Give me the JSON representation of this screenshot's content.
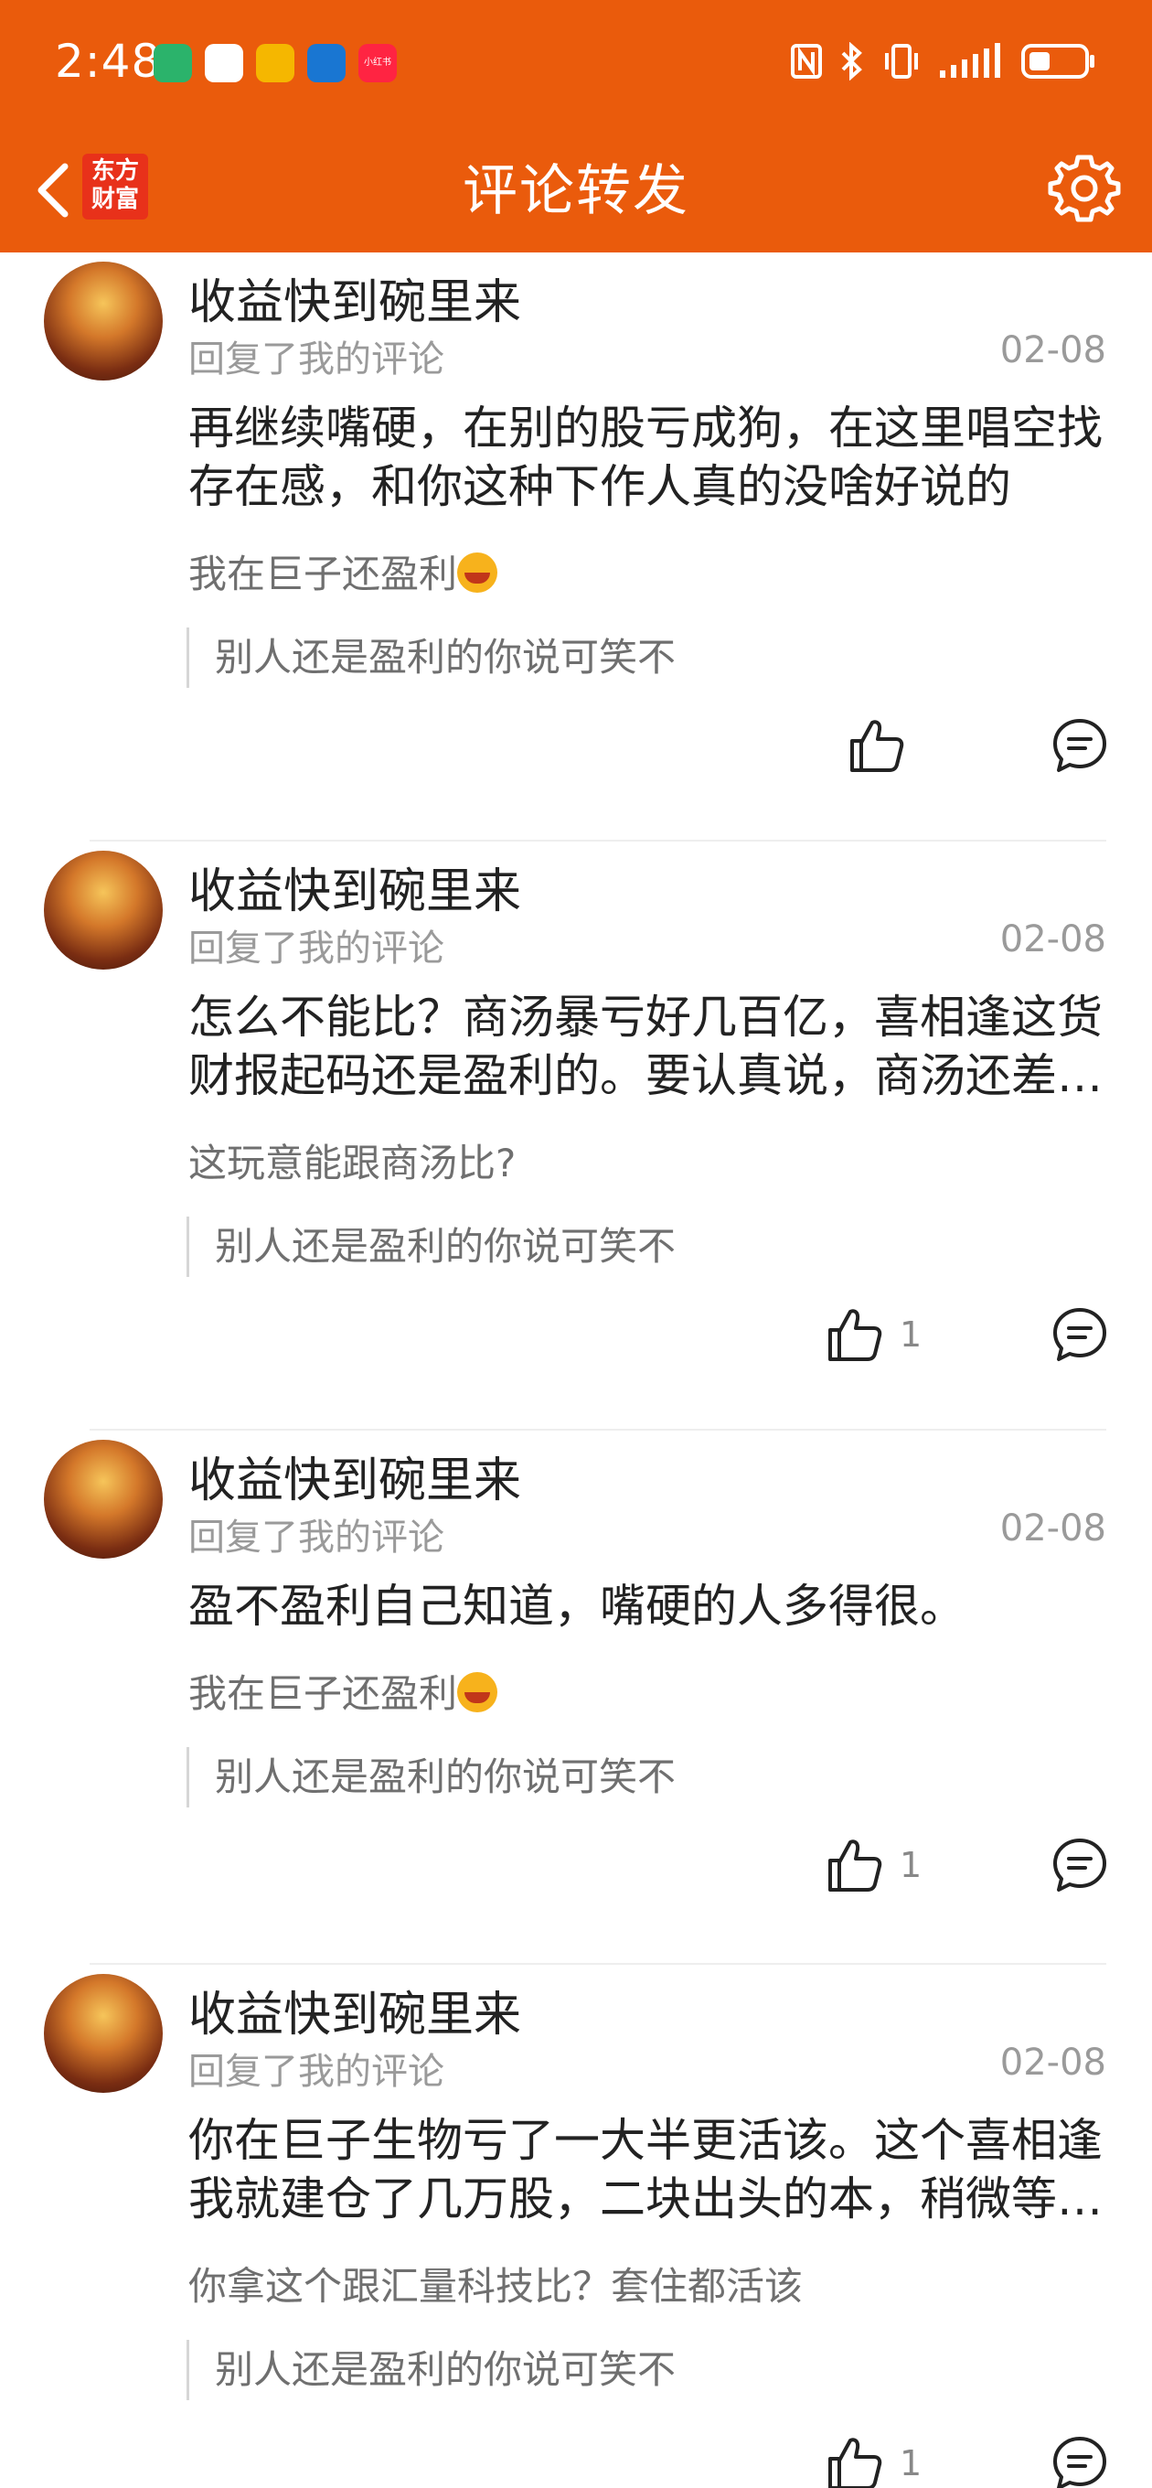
{
  "status": {
    "time": "2:48",
    "apps": [
      {
        "icon": "home-app-icon",
        "color": "#2bb36b"
      },
      {
        "icon": "bank-app-icon",
        "color": "#d4232b"
      },
      {
        "icon": "mail-app-icon",
        "color": "#f5b700"
      },
      {
        "icon": "up-app-icon",
        "color": "#1976d2"
      },
      {
        "icon": "xiaohongshu-app-icon",
        "color": "#ff2442",
        "label": "小红书"
      }
    ]
  },
  "header": {
    "title": "评论转发",
    "logo_line1": "东方",
    "logo_line2": "财富"
  },
  "comments": [
    {
      "user": "收益快到碗里来",
      "action": "回复了我的评论",
      "date": "02-08",
      "text": "再继续嘴硬，在别的股亏成狗，在这里唱空找存在感，和你这种下作人真的没啥好说的",
      "quoted": "我在巨子还盈利",
      "quoted_emoji": true,
      "original": "别人还是盈利的你说可笑不",
      "likes": ""
    },
    {
      "user": "收益快到碗里来",
      "action": "回复了我的评论",
      "date": "02-08",
      "text": "怎么不能比？商汤暴亏好几百亿，喜相逢这货财报起码还是盈利的。要认真说，商汤还差得远",
      "quoted": "这玩意能跟商汤比?",
      "quoted_emoji": false,
      "original": "别人还是盈利的你说可笑不",
      "likes": "1"
    },
    {
      "user": "收益快到碗里来",
      "action": "回复了我的评论",
      "date": "02-08",
      "text": "盈不盈利自己知道，嘴硬的人多得很。",
      "quoted": "我在巨子还盈利",
      "quoted_emoji": true,
      "original": "别人还是盈利的你说可笑不",
      "likes": "1"
    },
    {
      "user": "收益快到碗里来",
      "action": "回复了我的评论",
      "date": "02-08",
      "text": "你在巨子生物亏了一大半更活该。这个喜相逢我就建仓了几万股，二块出头的本，稍微等等就涨了",
      "quoted": "你拿这个跟汇量科技比？套住都活该",
      "quoted_emoji": false,
      "original": "别人还是盈利的你说可笑不",
      "likes": "1"
    }
  ]
}
